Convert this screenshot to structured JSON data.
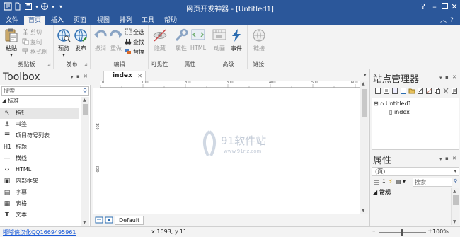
{
  "window": {
    "title": "网页开发神器 - [Untitled1]"
  },
  "menu": {
    "tabs": [
      "文件",
      "首页",
      "插入",
      "页面",
      "视图",
      "排列",
      "工具",
      "帮助"
    ],
    "active_index": 1
  },
  "ribbon": {
    "clipboard": {
      "label": "剪贴板",
      "paste": "粘贴",
      "cut": "剪切",
      "copy": "复制",
      "format_painter": "格式刷"
    },
    "publish": {
      "label": "发布",
      "preview": "预览",
      "publish": "发布"
    },
    "edit": {
      "label": "编辑",
      "undo": "撤消",
      "redo": "重做",
      "select_all": "全选",
      "find": "查找",
      "replace": "替换"
    },
    "visibility": {
      "label": "可见性",
      "hide": "隐藏"
    },
    "properties": {
      "label": "属性",
      "attributes": "属性",
      "html": "HTML"
    },
    "advanced": {
      "label": "高级",
      "animation": "动画",
      "events": "事件"
    },
    "link": {
      "label": "链接",
      "link": "链接"
    }
  },
  "toolbox": {
    "title": "Toolbox",
    "search_placeholder": "搜索",
    "category": "标准",
    "items": [
      {
        "label": "指针",
        "icon": "pointer-icon"
      },
      {
        "label": "书签",
        "icon": "anchor-icon"
      },
      {
        "label": "项目符号列表",
        "icon": "bullet-list-icon"
      },
      {
        "label": "标题",
        "icon": "heading-icon"
      },
      {
        "label": "横线",
        "icon": "horizontal-line-icon"
      },
      {
        "label": "HTML",
        "icon": "html-icon"
      },
      {
        "label": "内部框架",
        "icon": "iframe-icon"
      },
      {
        "label": "字幕",
        "icon": "marquee-icon"
      },
      {
        "label": "表格",
        "icon": "table-icon"
      },
      {
        "label": "文本",
        "icon": "text-icon"
      }
    ]
  },
  "document": {
    "tab_label": "index",
    "ruler_h": [
      "0",
      "100",
      "200",
      "300",
      "400",
      "500",
      "600"
    ],
    "ruler_v": [
      "100",
      "200"
    ],
    "page_selector": "Default",
    "watermark_text": "91软件站",
    "watermark_url": "www.91rjz.com"
  },
  "site_manager": {
    "title": "站点管理器",
    "tree": {
      "root": "Untitled1",
      "child": "index"
    }
  },
  "properties_panel": {
    "title": "属性",
    "object_select": "(页)",
    "search_placeholder": "搜索",
    "category": "常规"
  },
  "status": {
    "link_text": "嘟嘟侠汉化QQ1669495961",
    "coords": "x:1093, y:11",
    "zoom": "100%"
  },
  "colors": {
    "accent": "#2b579a",
    "link": "#1a5ad8"
  }
}
